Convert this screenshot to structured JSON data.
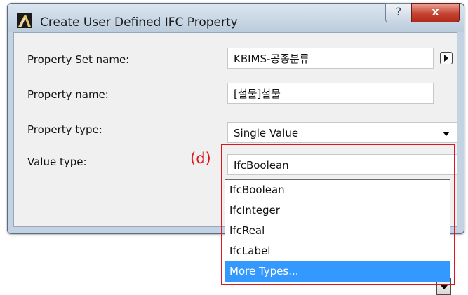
{
  "window": {
    "title": "Create User Defined IFC Property",
    "help_label": "?",
    "close_label": "x"
  },
  "fields": {
    "property_set_label": "Property Set name:",
    "property_set_value": "KBIMS-공종분류",
    "property_name_label": "Property name:",
    "property_name_value": "[철물]철물",
    "property_type_label": "Property type:",
    "property_type_value": "Single Value",
    "value_type_label": "Value type:",
    "value_type_value": "IfcBoolean"
  },
  "dropdown": {
    "items": [
      "IfcBoolean",
      "IfcInteger",
      "IfcReal",
      "IfcLabel",
      "More Types..."
    ],
    "highlighted": "More Types..."
  },
  "annotation": {
    "label": "(d)",
    "color": "#e0141e"
  },
  "colors": {
    "highlight": "#3399ff",
    "close_button": "#c64432"
  },
  "icons": {
    "app": "archicad-logo-icon",
    "set_picker": "triangle-right-icon",
    "dropdown": "chevron-down-icon"
  }
}
